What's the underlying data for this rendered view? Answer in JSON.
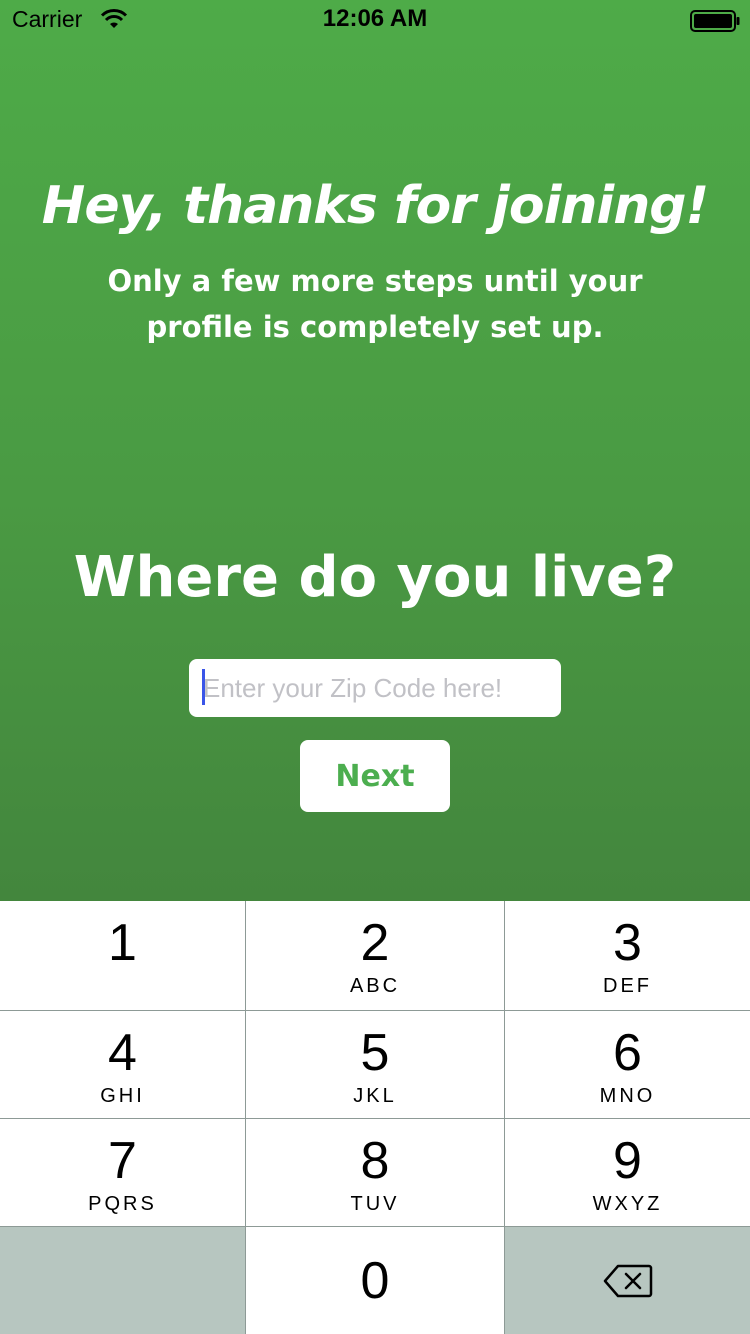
{
  "status_bar": {
    "carrier": "Carrier",
    "time": "12:06 AM",
    "wifi_icon": "wifi-icon",
    "battery_icon": "battery-icon"
  },
  "welcome": {
    "heading": "Hey, thanks for joining!",
    "subheading": "Only a few more steps until your profile is completely set up."
  },
  "location": {
    "question": "Where do you live?",
    "zip_placeholder": "Enter your Zip Code here!",
    "zip_value": "",
    "next_label": "Next"
  },
  "colors": {
    "background_top": "#4eab48",
    "background_bottom": "#43863d",
    "accent": "#4cae4f",
    "keypad_dark_key": "#b7c6c0"
  },
  "keypad": {
    "keys": [
      {
        "digit": "1",
        "letters": ""
      },
      {
        "digit": "2",
        "letters": "ABC"
      },
      {
        "digit": "3",
        "letters": "DEF"
      },
      {
        "digit": "4",
        "letters": "GHI"
      },
      {
        "digit": "5",
        "letters": "JKL"
      },
      {
        "digit": "6",
        "letters": "MNO"
      },
      {
        "digit": "7",
        "letters": "PQRS"
      },
      {
        "digit": "8",
        "letters": "TUV"
      },
      {
        "digit": "9",
        "letters": "WXYZ"
      },
      {
        "digit": "0",
        "letters": ""
      }
    ],
    "backspace_icon": "backspace-icon"
  }
}
